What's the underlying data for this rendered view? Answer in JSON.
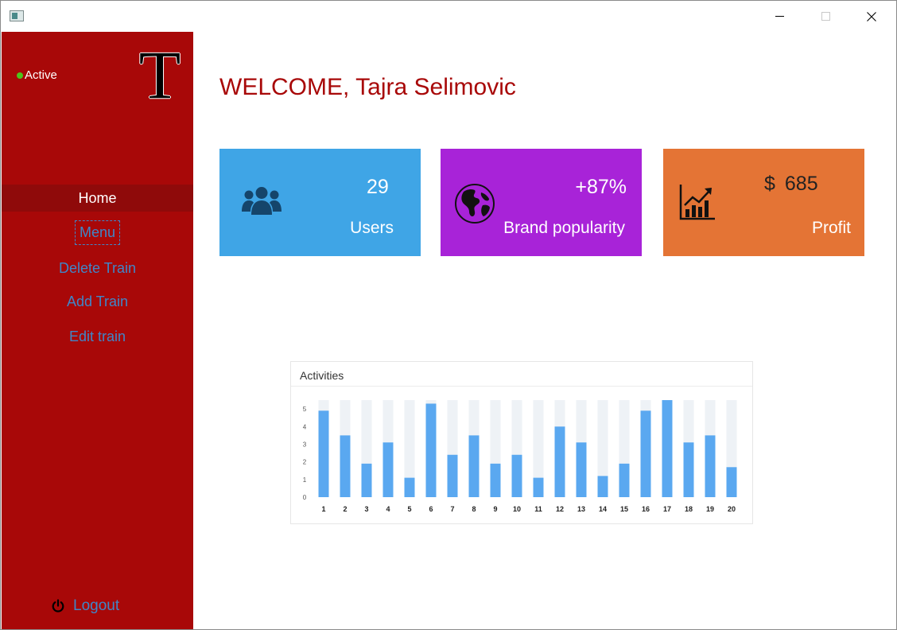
{
  "window": {
    "controls": {
      "minimize": "minimize",
      "maximize": "maximize",
      "close": "close"
    }
  },
  "sidebar": {
    "status_label": "Active",
    "logo_letter": "T",
    "nav": {
      "home": "Home",
      "menu": "Menu",
      "delete_train": "Delete Train",
      "add_train": "Add Train",
      "edit_train": "Edit train"
    },
    "logout_label": "Logout"
  },
  "main": {
    "welcome": "WELCOME, Tajra Selimovic",
    "cards": {
      "users": {
        "value": "29",
        "label": "Users",
        "icon": "users-icon"
      },
      "brand": {
        "value": "+87%",
        "label": "Brand popularity",
        "icon": "globe-icon"
      },
      "profit": {
        "currency": "$",
        "value": "685",
        "label": "Profit",
        "icon": "growth-chart-icon"
      }
    }
  },
  "colors": {
    "sidebar": "#a80808",
    "sidebar_active": "#8f0a0a",
    "nav_text": "#3f86c8",
    "welcome_text": "#a80808",
    "card_users": "#3fa5e6",
    "card_brand": "#a823d8",
    "card_profit": "#e47435",
    "status_dot": "#4cc41c",
    "bar": "#5aa8f0",
    "bar_track": "#eef2f6"
  },
  "chart_data": {
    "type": "bar",
    "title": "Activities",
    "categories": [
      "1",
      "2",
      "3",
      "4",
      "5",
      "6",
      "7",
      "8",
      "9",
      "10",
      "11",
      "12",
      "13",
      "14",
      "15",
      "16",
      "17",
      "18",
      "19",
      "20"
    ],
    "values": [
      4.9,
      3.5,
      1.9,
      3.1,
      1.1,
      5.3,
      2.4,
      3.5,
      1.9,
      2.4,
      1.1,
      4.0,
      3.1,
      1.2,
      1.9,
      4.9,
      5.5,
      3.1,
      3.5,
      1.7
    ],
    "yticks": [
      0,
      1,
      2,
      3,
      4,
      5
    ],
    "ylim": [
      0,
      5.5
    ],
    "grid": false,
    "legend": "none"
  }
}
